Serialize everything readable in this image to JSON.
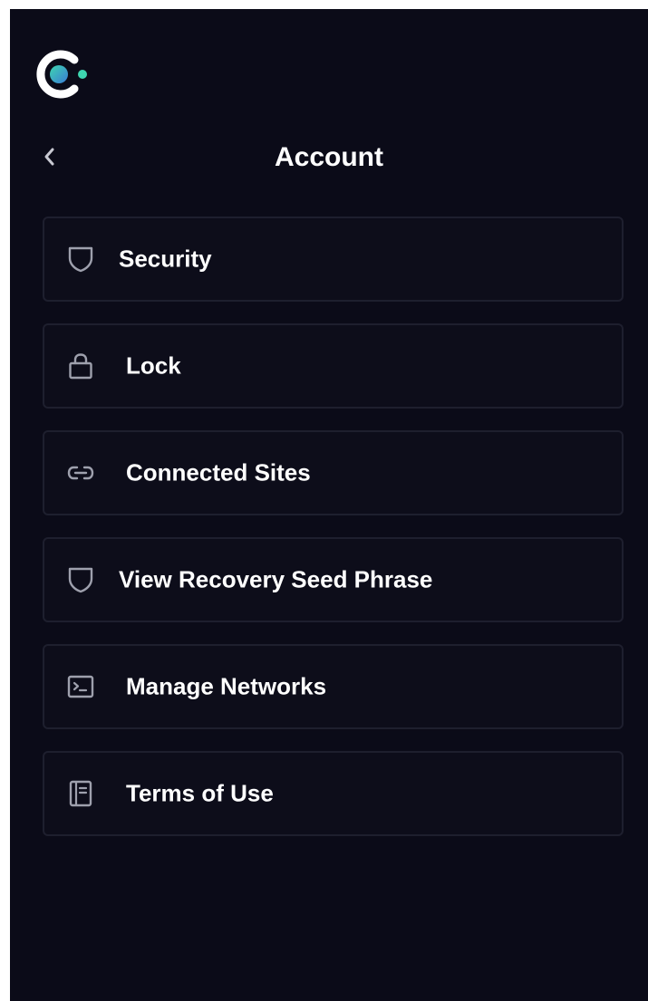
{
  "header": {
    "title": "Account",
    "back_icon": "chevron-left-icon",
    "logo_icon": "brand-logo-icon"
  },
  "menu": {
    "items": [
      {
        "label": "Security",
        "icon": "shield-icon"
      },
      {
        "label": "Lock",
        "icon": "lock-icon"
      },
      {
        "label": "Connected Sites",
        "icon": "link-icon"
      },
      {
        "label": "View Recovery Seed Phrase",
        "icon": "shield-icon"
      },
      {
        "label": "Manage Networks",
        "icon": "terminal-icon"
      },
      {
        "label": "Terms of Use",
        "icon": "document-icon"
      }
    ]
  },
  "colors": {
    "background": "#0b0b18",
    "card_border": "#1e1f2e",
    "text": "#ffffff",
    "icon": "#9ea0ad",
    "logo_ring": "#ffffff",
    "logo_accent": "#3ed6b0",
    "logo_inner": "#3a7bd5"
  }
}
